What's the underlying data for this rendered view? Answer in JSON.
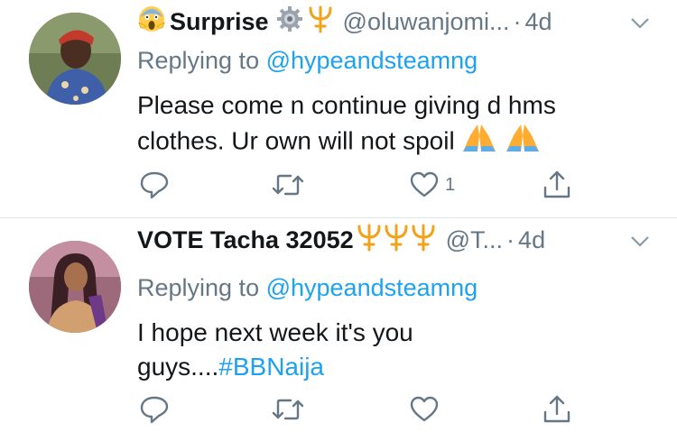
{
  "tweets": [
    {
      "display_name": "Surprise",
      "handle": "@oluwanjomi...",
      "time": "4d",
      "replying_prefix": "Replying to ",
      "replying_to": "@hypeandsteamng",
      "text_line1": "Please come n continue giving d hms",
      "text_line2": "clothes. Ur own will not spoil",
      "like_count": "1",
      "icons": [
        "screaming-face-emoji",
        "gear-icon",
        "trident-emoji",
        "folded-hands-emoji"
      ]
    },
    {
      "display_name": "VOTE Tacha 32052",
      "handle": "@T...",
      "time": "4d",
      "replying_prefix": "Replying to ",
      "replying_to": "@hypeandsteamng",
      "text_line1": "I hope next week it's you",
      "text_line2_prefix": "guys....",
      "hashtag": "#BBNaija",
      "icons": [
        "trident-emoji",
        "trident-emoji",
        "trident-emoji"
      ]
    }
  ],
  "separator": "·",
  "colors": {
    "text": "#14171a",
    "secondary": "#657786",
    "link": "#1da1f2",
    "divider": "#e1e8ed",
    "trident": "#f2a31b"
  }
}
